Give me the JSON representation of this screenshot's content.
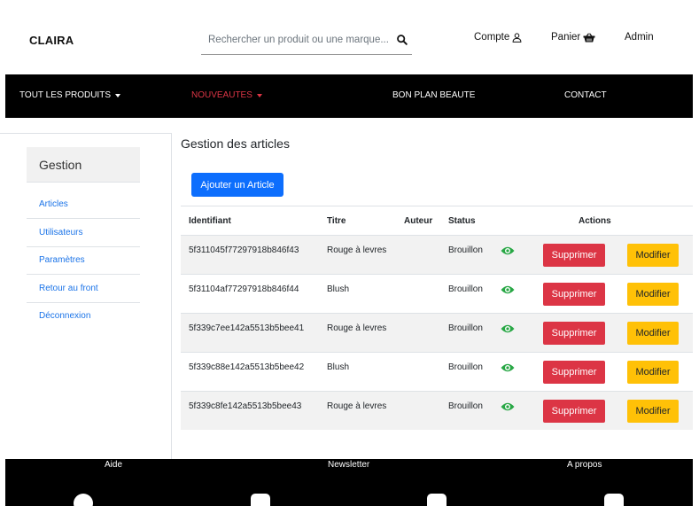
{
  "header": {
    "brand": "CLAIRA",
    "search_placeholder": "Rechercher un produit ou une marque...",
    "account_label": "Compte",
    "cart_label": "Panier",
    "admin_label": "Admin"
  },
  "nav": {
    "items": [
      {
        "label": "TOUT LES PRODUITS",
        "dropdown": true
      },
      {
        "label": "NOUVEAUTES",
        "dropdown": true,
        "color": "#dc3545"
      },
      {
        "label": "BON PLAN BEAUTE",
        "dropdown": false
      },
      {
        "label": "CONTACT",
        "dropdown": false
      }
    ]
  },
  "sidebar": {
    "title": "Gestion",
    "items": [
      {
        "label": "Articles"
      },
      {
        "label": "Utilisateurs"
      },
      {
        "label": "Paramètres"
      },
      {
        "label": "Retour au front"
      },
      {
        "label": "Déconnexion"
      }
    ]
  },
  "main": {
    "title": "Gestion des articles",
    "add_button": "Ajouter un Article",
    "columns": [
      "Identifiant",
      "Titre",
      "Auteur",
      "Status",
      "Actions"
    ],
    "rows": [
      {
        "id": "5f311045f77297918b846f43",
        "title": "Rouge à levres",
        "author": "",
        "status": "Brouillon"
      },
      {
        "id": "5f31104af77297918b846f44",
        "title": "Blush",
        "author": "",
        "status": "Brouillon"
      },
      {
        "id": "5f339c7ee142a5513b5bee41",
        "title": "Rouge à levres",
        "author": "",
        "status": "Brouillon"
      },
      {
        "id": "5f339c88e142a5513b5bee42",
        "title": "Blush",
        "author": "",
        "status": "Brouillon"
      },
      {
        "id": "5f339c8fe142a5513b5bee43",
        "title": "Rouge à levres",
        "author": "",
        "status": "Brouillon"
      }
    ],
    "delete_label": "Supprimer",
    "edit_label": "Modifier"
  },
  "footer": {
    "links": [
      "Aide",
      "Newsletter",
      "A propos"
    ],
    "social_icons": [
      "facebook-icon",
      "youtube-icon",
      "instagram-icon",
      "user-icon"
    ]
  },
  "colors": {
    "primary": "#0d6efd",
    "danger": "#dc3545",
    "warning": "#ffc107",
    "success": "#28a745",
    "nav_bg": "#000000"
  }
}
